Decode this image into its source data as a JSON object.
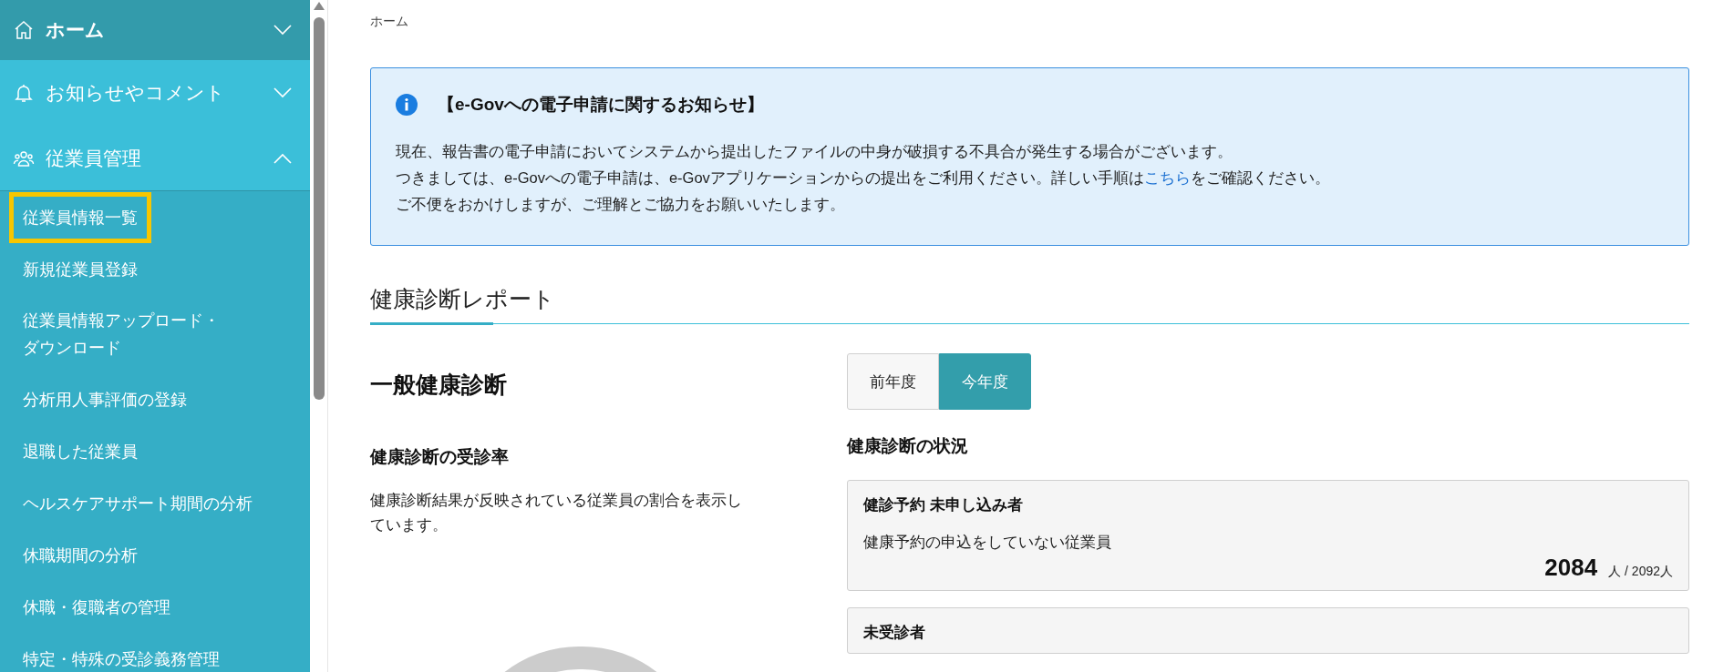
{
  "sidebar": {
    "sections": [
      {
        "label": "ホーム",
        "kind": "home",
        "expanded": false
      },
      {
        "label": "お知らせやコメント",
        "kind": "bell",
        "expanded": false
      },
      {
        "label": "従業員管理",
        "kind": "people",
        "expanded": true,
        "children": [
          {
            "label": "従業員情報一覧",
            "selected": true
          },
          {
            "label": "新規従業員登録",
            "selected": false
          },
          {
            "lines": [
              "従業員情報アップロード・",
              "ダウンロード"
            ],
            "selected": false
          },
          {
            "label": "分析用人事評価の登録",
            "selected": false
          },
          {
            "label": "退職した従業員",
            "selected": false
          },
          {
            "label": "ヘルスケアサポート期間の分析",
            "selected": false
          },
          {
            "label": "休職期間の分析",
            "selected": false
          },
          {
            "label": "休職・復職者の管理",
            "selected": false
          },
          {
            "label": "特定・特殊の受診義務管理",
            "selected": false
          }
        ]
      }
    ]
  },
  "breadcrumb": "ホーム",
  "notice": {
    "title": "【e-Govへの電子申請に関するお知らせ】",
    "lines": [
      {
        "text": "現在、報告書の電子申請においてシステムから提出したファイルの中身が破損する不具合が発生する場合がございます。"
      },
      {
        "text": "つきましては、e-Govへの電子申請は、e-Govアプリケーションからの提出をご利用ください。詳しい手順は",
        "link": "こちら",
        "after": "をご確認ください。"
      },
      {
        "text": "ご不便をおかけしますが、ご理解とご協力をお願いいたします。"
      }
    ]
  },
  "section_title": "健康診断レポート",
  "report": {
    "title": "一般健康診断",
    "tabs": [
      {
        "label": "前年度",
        "selected": false
      },
      {
        "label": "今年度",
        "selected": true
      }
    ],
    "rate": {
      "title": "健康診断の受診率",
      "description": "健康診断結果が反映されている従業員の割合を表示しています。"
    },
    "status": {
      "title": "健康診断の状況",
      "cards": [
        {
          "title": "健診予約 未申し込み者",
          "description": "健康予約の申込をしていない従業員",
          "count": "2084",
          "total": "人 / 2092人"
        },
        {
          "title": "未受診者"
        }
      ]
    }
  }
}
